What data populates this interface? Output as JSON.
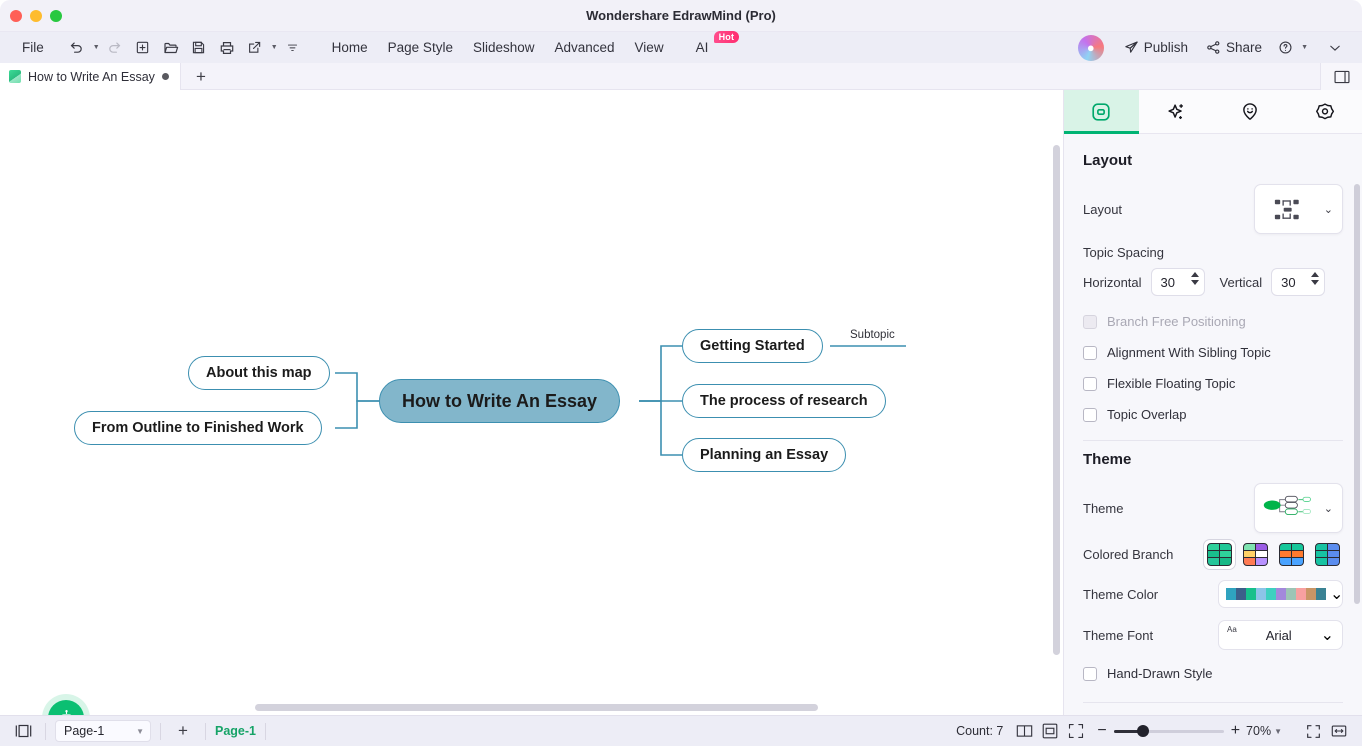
{
  "window": {
    "title": "Wondershare EdrawMind (Pro)",
    "controls": [
      "close",
      "minimize",
      "maximize"
    ]
  },
  "menubar": {
    "file_label": "File",
    "quick_tools": [
      {
        "name": "undo-icon",
        "enabled": true,
        "has_dropdown": true
      },
      {
        "name": "redo-icon",
        "enabled": false,
        "has_dropdown": false
      },
      {
        "name": "new-icon",
        "enabled": true,
        "has_dropdown": false
      },
      {
        "name": "open-folder-icon",
        "enabled": true,
        "has_dropdown": false
      },
      {
        "name": "save-icon",
        "enabled": true,
        "has_dropdown": false
      },
      {
        "name": "print-icon",
        "enabled": true,
        "has_dropdown": false
      },
      {
        "name": "export-icon",
        "enabled": true,
        "has_dropdown": true
      },
      {
        "name": "more-tools-icon",
        "enabled": true,
        "has_dropdown": false
      }
    ],
    "tabs": [
      "Home",
      "Page Style",
      "Slideshow",
      "Advanced",
      "View"
    ],
    "ai_label": "AI",
    "ai_badge": "Hot",
    "publish_label": "Publish",
    "share_label": "Share",
    "help_icon": "help-icon",
    "collapse_icon": "chevron-down-icon"
  },
  "tabstrip": {
    "document_tab": "How to Write An Essay",
    "modified_marker": "●",
    "new_tab_label": "+"
  },
  "mindmap": {
    "root": "How to Write An Essay",
    "left_branches": [
      "About this map",
      "From Outline to Finished Work"
    ],
    "right_branches": [
      "Getting Started",
      "The process of research",
      "Planning an Essay"
    ],
    "floating_label": "Subtopic",
    "colors": {
      "root_fill": "#82b6cb",
      "branch_border": "#3c8fb0",
      "branch_fill": "#ffffff",
      "link": "#3c8fb0"
    },
    "ai_assistant_icon": "robot-icon"
  },
  "panel": {
    "tabs": [
      {
        "name": "shape-tab",
        "icon": "rounded-square-icon",
        "active": true
      },
      {
        "name": "ai-tab",
        "icon": "sparkles-icon",
        "active": false
      },
      {
        "name": "sticker-tab",
        "icon": "smiley-pin-icon",
        "active": false
      },
      {
        "name": "icon-tab",
        "icon": "flower-icon",
        "active": false
      }
    ],
    "layout_section": {
      "title": "Layout",
      "layout_label": "Layout",
      "layout_value_icon": "balanced-map-icon",
      "topic_spacing_label": "Topic Spacing",
      "horizontal_label": "Horizontal",
      "horizontal_value": "30",
      "vertical_label": "Vertical",
      "vertical_value": "30",
      "checkboxes": [
        {
          "label": "Branch Free Positioning",
          "checked": false,
          "disabled": true
        },
        {
          "label": "Alignment With Sibling Topic",
          "checked": false,
          "disabled": false
        },
        {
          "label": "Flexible Floating Topic",
          "checked": false,
          "disabled": false
        },
        {
          "label": "Topic Overlap",
          "checked": false,
          "disabled": false
        }
      ]
    },
    "theme_section": {
      "title": "Theme",
      "theme_label": "Theme",
      "theme_preview_icon": "green-mindmap-thumb",
      "colored_branch_label": "Colored Branch",
      "colored_branch_options": [
        {
          "selected": true,
          "colors": [
            "#2fd19a",
            "#20c997",
            "#19bf8d",
            "#2fd19a",
            "#26c79a",
            "#18b886"
          ]
        },
        {
          "selected": false,
          "colors": [
            "#7ee3b0",
            "#9b5de5",
            "#ffd166",
            "#ffffff",
            "#ff7b54",
            "#b892ff"
          ]
        },
        {
          "selected": false,
          "colors": [
            "#16c79a",
            "#16c79a",
            "#ff7a2f",
            "#ff7a2f",
            "#4aa3ff",
            "#4aa3ff"
          ]
        },
        {
          "selected": false,
          "colors": [
            "#17c3a2",
            "#5b8def",
            "#17c3a2",
            "#5b8def",
            "#17c3a2",
            "#5b8def"
          ]
        }
      ],
      "theme_color_label": "Theme Color",
      "theme_color_swatches": [
        "#2fa3bf",
        "#3c5f8a",
        "#17c08c",
        "#8cc4e8",
        "#3fcfc0",
        "#a388db",
        "#9dc4b5",
        "#f8a0a0",
        "#c99566",
        "#3a8293"
      ],
      "theme_font_label": "Theme Font",
      "theme_font_value": "Arial",
      "theme_font_icon": "Aa",
      "hand_drawn_label": "Hand-Drawn Style",
      "hand_drawn_checked": false
    }
  },
  "statusbar": {
    "outline_icon": "panel-layout-icon",
    "page_select_value": "Page-1",
    "add_page_label": "+",
    "current_page": "Page-1",
    "count_label": "Count: 7",
    "view_icons": [
      "book-view-icon",
      "fit-page-icon",
      "full-canvas-icon"
    ],
    "zoom_out": "−",
    "zoom_in": "+",
    "zoom_value": "70%",
    "right_icons": [
      "fullscreen-icon",
      "fit-width-icon"
    ]
  }
}
